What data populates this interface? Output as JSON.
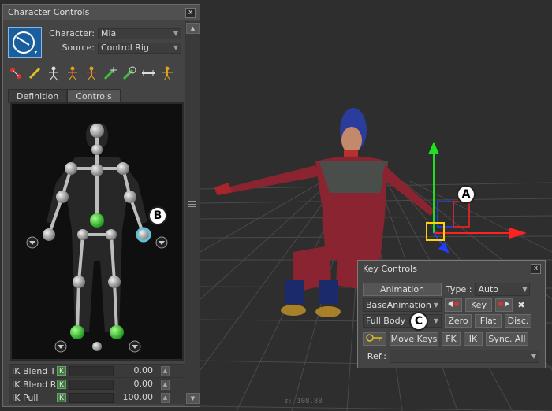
{
  "viewport": {
    "coords": "z: 108.88"
  },
  "character_controls": {
    "title": "Character Controls",
    "close": "x",
    "character_label": "Character:",
    "character_value": "Mia",
    "source_label": "Source:",
    "source_value": "Control Rig",
    "tabs": [
      "Definition",
      "Controls"
    ],
    "active_tab": "Controls",
    "toolbar_icons": [
      "select-effector-icon",
      "pin-icon",
      "full-body-icon",
      "body-part-icon",
      "fk-icon",
      "pin-translation-icon",
      "pin-rotation-icon",
      "release-icon",
      "stance-icon"
    ],
    "properties": [
      {
        "name": "IK Blend T",
        "key": "K",
        "value": "0.00"
      },
      {
        "name": "IK Blend R",
        "key": "K",
        "value": "0.00"
      },
      {
        "name": "IK Pull",
        "key": "K",
        "value": "100.00"
      }
    ]
  },
  "key_controls": {
    "title": "Key Controls",
    "close": "x",
    "animation_btn": "Animation",
    "type_label": "Type :",
    "type_value": "Auto",
    "layer_value": "BaseAnimation",
    "key_btn": "Key",
    "keying_mode": "Full Body",
    "zero_btn": "Zero",
    "flat_btn": "Flat",
    "disc_btn": "Disc.",
    "move_keys_btn": "Move Keys",
    "fk_btn": "FK",
    "ik_btn": "IK",
    "sync_btn": "Sync. All",
    "ref_label": "Ref.:"
  },
  "callouts": {
    "a": "A",
    "b": "B",
    "c": "C"
  },
  "colors": {
    "selected_effector": "#3fc43f",
    "hover_effector": "#5fc0d8",
    "manip_x": "#ff2020",
    "manip_y": "#20ff20",
    "manip_z": "#2040ff"
  }
}
